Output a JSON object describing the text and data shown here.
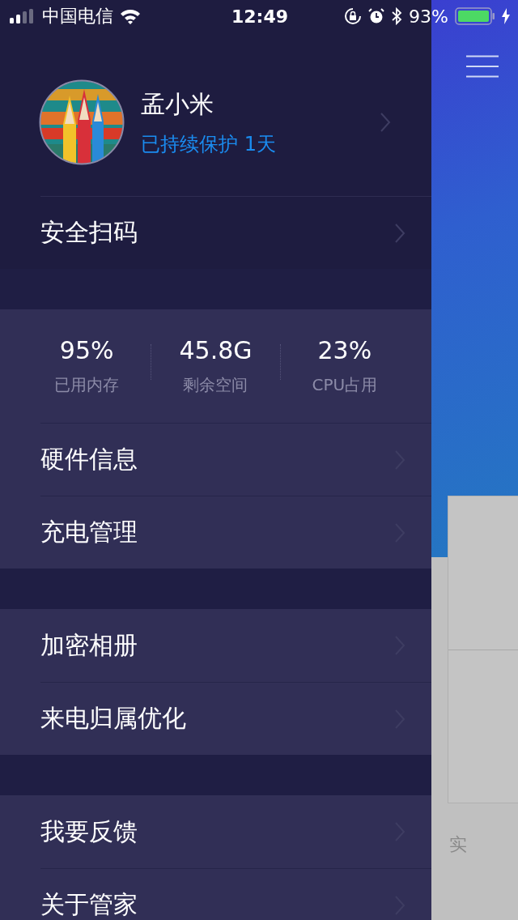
{
  "status_bar": {
    "carrier": "中国电信",
    "time": "12:49",
    "battery": "93%"
  },
  "profile": {
    "name": "孟小米",
    "status": "已持续保护 1天"
  },
  "security_item": {
    "label": "安全扫码"
  },
  "groups": [
    {
      "stats": [
        {
          "value": "95%",
          "label": "已用内存"
        },
        {
          "value": "45.8G",
          "label": "剩余空间"
        },
        {
          "value": "23%",
          "label": "CPU占用"
        }
      ],
      "items": [
        {
          "label": "硬件信息"
        },
        {
          "label": "充电管理"
        }
      ]
    },
    {
      "items": [
        {
          "label": "加密相册"
        },
        {
          "label": "来电归属优化"
        }
      ]
    },
    {
      "items": [
        {
          "label": "我要反馈"
        },
        {
          "label": "关于管家"
        }
      ]
    }
  ],
  "background_page": {
    "text": "实"
  }
}
